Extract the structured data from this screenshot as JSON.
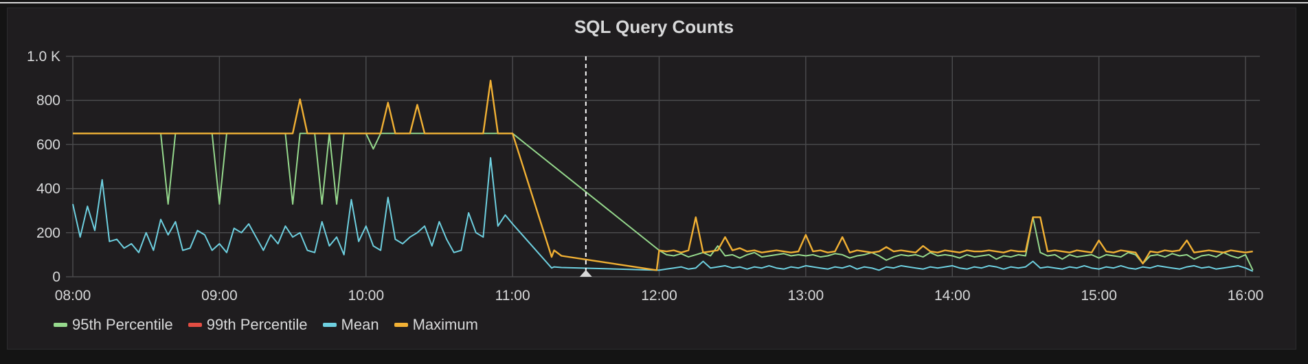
{
  "chart_data": {
    "type": "line",
    "title": "SQL Query Counts",
    "xlabel": "",
    "ylabel": "",
    "ylim": [
      0,
      1000
    ],
    "y_ticks": [
      {
        "value": 0,
        "label": "0"
      },
      {
        "value": 200,
        "label": "200"
      },
      {
        "value": 400,
        "label": "400"
      },
      {
        "value": 600,
        "label": "600"
      },
      {
        "value": 800,
        "label": "800"
      },
      {
        "value": 1000,
        "label": "1.0 K"
      }
    ],
    "x_unit": "minutes since 08:00",
    "xlim": [
      0,
      486
    ],
    "x_ticks": [
      {
        "value": 0,
        "label": "08:00"
      },
      {
        "value": 60,
        "label": "09:00"
      },
      {
        "value": 120,
        "label": "10:00"
      },
      {
        "value": 180,
        "label": "11:00"
      },
      {
        "value": 240,
        "label": "12:00"
      },
      {
        "value": 300,
        "label": "13:00"
      },
      {
        "value": 360,
        "label": "14:00"
      },
      {
        "value": 420,
        "label": "15:00"
      },
      {
        "value": 480,
        "label": "16:00"
      }
    ],
    "grid": true,
    "legend_position": "bottom-left",
    "annotation": {
      "x": 210,
      "style": "dashed-vertical-marker"
    },
    "segments": [
      {
        "x_start": 0,
        "x_step": 3,
        "count": 61
      },
      {
        "x_start": 240,
        "x_step": 3,
        "count": 82
      }
    ],
    "gap_points": {
      "x": [
        196,
        197,
        200,
        239
      ],
      "Mean": [
        40,
        45,
        42,
        30
      ],
      "Maximum": [
        90,
        120,
        95,
        30
      ]
    },
    "series": [
      {
        "name": "95th Percentile",
        "color": "#96d98d",
        "segments": [
          [
            650,
            650,
            650,
            650,
            650,
            650,
            650,
            650,
            650,
            650,
            650,
            650,
            650,
            330,
            650,
            650,
            650,
            650,
            650,
            650,
            330,
            650,
            650,
            650,
            650,
            650,
            650,
            650,
            650,
            650,
            330,
            650,
            650,
            650,
            330,
            650,
            330,
            650,
            650,
            650,
            650,
            580,
            650,
            650,
            650,
            650,
            650,
            650,
            650,
            650,
            650,
            650,
            650,
            650,
            650,
            650,
            650,
            650,
            650,
            650,
            650
          ],
          [
            120,
            100,
            95,
            105,
            90,
            100,
            110,
            95,
            140,
            95,
            100,
            85,
            100,
            110,
            90,
            95,
            100,
            105,
            95,
            100,
            95,
            100,
            90,
            95,
            105,
            100,
            85,
            95,
            100,
            110,
            95,
            75,
            90,
            100,
            95,
            100,
            90,
            110,
            95,
            100,
            95,
            85,
            100,
            90,
            95,
            100,
            80,
            95,
            90,
            100,
            95,
            270,
            110,
            95,
            100,
            80,
            100,
            90,
            95,
            100,
            85,
            100,
            95,
            90,
            110,
            100,
            60,
            95,
            100,
            90,
            105,
            95,
            100,
            80,
            95,
            100,
            90,
            110,
            95,
            85,
            100,
            30
          ]
        ]
      },
      {
        "name": "99th Percentile",
        "color": "#e24d42",
        "segments": [
          [],
          []
        ]
      },
      {
        "name": "Mean",
        "color": "#6ed0e0",
        "segments": [
          [
            330,
            180,
            320,
            210,
            440,
            160,
            170,
            130,
            150,
            110,
            200,
            120,
            260,
            190,
            250,
            120,
            130,
            210,
            190,
            120,
            150,
            110,
            220,
            200,
            240,
            180,
            120,
            190,
            150,
            230,
            180,
            200,
            120,
            110,
            250,
            140,
            180,
            100,
            350,
            160,
            230,
            140,
            120,
            360,
            170,
            150,
            180,
            200,
            230,
            140,
            250,
            170,
            110,
            120,
            290,
            200,
            180,
            540,
            230,
            280,
            240
          ],
          [
            30,
            35,
            40,
            45,
            35,
            40,
            70,
            40,
            45,
            50,
            40,
            45,
            35,
            45,
            40,
            50,
            40,
            35,
            45,
            40,
            50,
            45,
            40,
            35,
            45,
            40,
            50,
            35,
            45,
            40,
            30,
            45,
            40,
            50,
            45,
            40,
            35,
            45,
            40,
            45,
            50,
            40,
            35,
            45,
            40,
            50,
            45,
            35,
            45,
            40,
            45,
            70,
            40,
            45,
            40,
            35,
            45,
            40,
            50,
            40,
            35,
            45,
            40,
            50,
            40,
            35,
            45,
            40,
            50,
            45,
            40,
            35,
            45,
            50,
            40,
            45,
            35,
            40,
            45,
            50,
            40,
            25
          ]
        ]
      },
      {
        "name": "Maximum",
        "color": "#f2b134",
        "segments": [
          [
            650,
            650,
            650,
            650,
            650,
            650,
            650,
            650,
            650,
            650,
            650,
            650,
            650,
            650,
            650,
            650,
            650,
            650,
            650,
            650,
            650,
            650,
            650,
            650,
            650,
            650,
            650,
            650,
            650,
            650,
            650,
            805,
            650,
            650,
            650,
            650,
            650,
            650,
            650,
            650,
            650,
            650,
            650,
            790,
            650,
            650,
            650,
            780,
            650,
            650,
            650,
            650,
            650,
            650,
            650,
            650,
            650,
            890,
            650,
            650,
            650
          ],
          [
            120,
            115,
            120,
            110,
            120,
            270,
            110,
            115,
            120,
            180,
            120,
            130,
            115,
            120,
            110,
            115,
            120,
            115,
            110,
            115,
            190,
            115,
            120,
            110,
            115,
            180,
            110,
            120,
            115,
            110,
            115,
            135,
            115,
            120,
            115,
            110,
            140,
            115,
            110,
            120,
            115,
            110,
            120,
            115,
            115,
            120,
            115,
            110,
            120,
            115,
            115,
            270,
            270,
            115,
            120,
            115,
            110,
            120,
            115,
            110,
            165,
            115,
            110,
            120,
            115,
            110,
            60,
            115,
            110,
            120,
            115,
            120,
            165,
            110,
            115,
            120,
            115,
            110,
            120,
            115,
            110,
            115
          ]
        ]
      }
    ]
  },
  "legend": [
    {
      "label": "95th Percentile",
      "color": "#96d98d"
    },
    {
      "label": "99th Percentile",
      "color": "#e24d42"
    },
    {
      "label": "Mean",
      "color": "#6ed0e0"
    },
    {
      "label": "Maximum",
      "color": "#f2b134"
    }
  ]
}
